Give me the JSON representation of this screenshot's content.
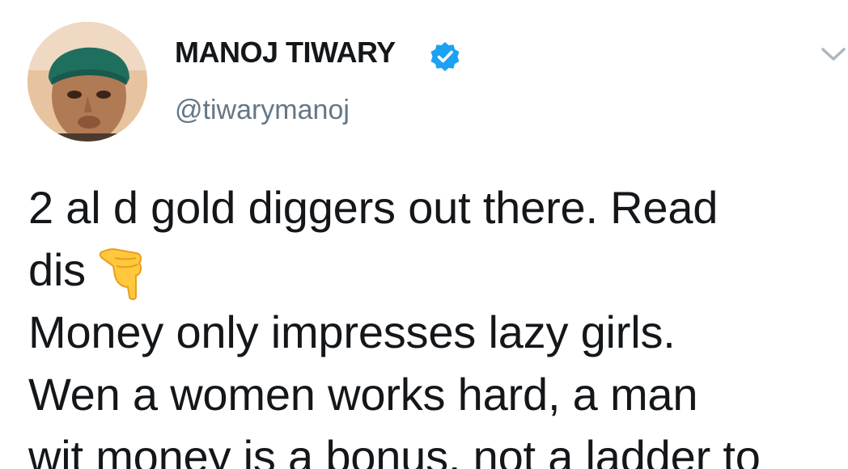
{
  "author": {
    "display_name": "MANOJ TIWARY",
    "handle": "@tiwarymanoj",
    "verified": true
  },
  "tweet": {
    "lines": [
      "2 al d gold diggers out there. Read",
      "dis",
      "Money only impresses lazy girls.",
      "Wen a women works hard, a man",
      "wit money is a bonus, not a ladder to"
    ],
    "inline_emoji": "backhand-index-pointing-down"
  },
  "icons": {
    "verified": "verified-badge-icon",
    "menu": "chevron-down-icon"
  },
  "colors": {
    "text": "#14171a",
    "secondary": "#657786",
    "verified_blue": "#1da1f2",
    "emoji_yellow": "#ffc83d"
  }
}
